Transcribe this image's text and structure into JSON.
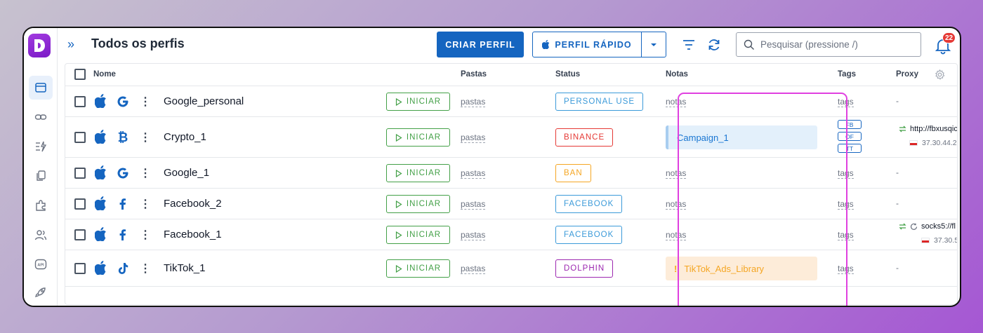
{
  "header": {
    "title": "Todos os perfis",
    "create_label": "CRIAR PERFIL",
    "quick_label": "PERFIL RÁPIDO",
    "search_placeholder": "Pesquisar (pressione /)",
    "notification_count": "22"
  },
  "columns": {
    "name": "Nome",
    "folders": "Pastas",
    "status": "Status",
    "notes": "Notas",
    "tags": "Tags",
    "proxy": "Proxy"
  },
  "rows": [
    {
      "name": "Google_personal",
      "os": "apple-icon",
      "brand": "google-icon",
      "start": "INICIAR",
      "folders": "pastas",
      "status": "PERSONAL USE",
      "status_color": "#3b9ad9",
      "notes": "notas",
      "tags": "tags",
      "proxy": "-"
    },
    {
      "name": "Crypto_1",
      "os": "apple-icon",
      "brand": "bitcoin-icon",
      "start": "INICIAR",
      "folders": "pastas",
      "status": "BINANCE",
      "status_color": "#e53935",
      "notes": "Campaign_1",
      "tags_list": [
        "FB",
        "OF",
        "TT"
      ],
      "proxy_host": "http://fbxusqic",
      "proxy_ip": "37.30.44.2"
    },
    {
      "name": "Google_1",
      "os": "apple-icon",
      "brand": "google-icon",
      "start": "INICIAR",
      "folders": "pastas",
      "status": "BAN",
      "status_color": "#f5a623",
      "notes": "notas",
      "tags": "tags",
      "proxy": "-"
    },
    {
      "name": "Facebook_2",
      "os": "apple-icon",
      "brand": "facebook-icon",
      "start": "INICIAR",
      "folders": "pastas",
      "status": "FACEBOOK",
      "status_color": "#3b9ad9",
      "notes": "notas",
      "tags": "tags",
      "proxy": "-"
    },
    {
      "name": "Facebook_1",
      "os": "apple-icon",
      "brand": "facebook-icon",
      "start": "INICIAR",
      "folders": "pastas",
      "status": "FACEBOOK",
      "status_color": "#3b9ad9",
      "notes": "notas",
      "tags": "tags",
      "proxy_host": "socks5://fl",
      "proxy_ip": "37.30.5"
    },
    {
      "name": "TikTok_1",
      "os": "apple-icon",
      "brand": "tiktok-icon",
      "start": "INICIAR",
      "folders": "pastas",
      "status": "DOLPHIN",
      "status_color": "#9c27b0",
      "notes": "TikTok_Ads_Library",
      "notes_mark": "!",
      "tags": "tags",
      "proxy": "-"
    }
  ],
  "colors": {
    "primary": "#1565c0",
    "start_green": "#43a047",
    "highlight": "#e040e0",
    "note_blue_bg": "#e3f0fb",
    "note_orange_bg": "#fdecd9"
  }
}
